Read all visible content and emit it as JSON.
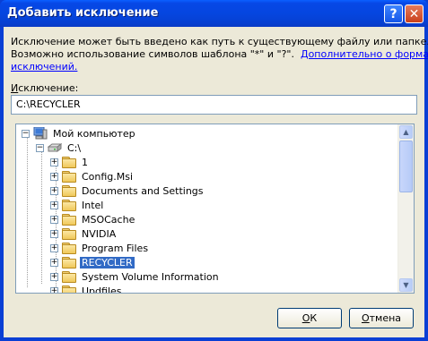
{
  "window": {
    "title": "Добавить исключение",
    "help_glyph": "?",
    "close_glyph": "✕"
  },
  "description": {
    "line1": "Исключение может быть введено как путь к существующему файлу или папке.",
    "line2_prefix": "Возможно использование символов шаблона \"*\" и \"?\".",
    "link_part1": "Дополнительно о форматах",
    "link_part2": "исключений."
  },
  "exclusion": {
    "label_first": "И",
    "label_rest": "сключение:",
    "value": "C:\\RECYCLER"
  },
  "tree": {
    "root": {
      "label": "Мой компьютер",
      "icon": "my-computer-icon",
      "expanded": true
    },
    "drive": {
      "label": "C:\\",
      "icon": "hard-drive-icon",
      "expanded": true
    },
    "folders": [
      {
        "label": "1",
        "icon": "folder-icon",
        "expander": "+"
      },
      {
        "label": "Config.Msi",
        "icon": "folder-icon",
        "expander": "+"
      },
      {
        "label": "Documents and Settings",
        "icon": "folder-icon",
        "expander": "+"
      },
      {
        "label": "Intel",
        "icon": "folder-icon",
        "expander": "+"
      },
      {
        "label": "MSOCache",
        "icon": "folder-icon",
        "expander": "+"
      },
      {
        "label": "NVIDIA",
        "icon": "folder-icon",
        "expander": "+"
      },
      {
        "label": "Program Files",
        "icon": "folder-icon",
        "expander": "+"
      },
      {
        "label": "RECYCLER",
        "icon": "folder-icon",
        "expander": "+",
        "selected": true
      },
      {
        "label": "System Volume Information",
        "icon": "folder-icon",
        "expander": "+"
      },
      {
        "label": "Updfiles",
        "icon": "folder-icon",
        "expander": "+"
      }
    ],
    "root_expander": "−",
    "drive_expander": "−"
  },
  "buttons": {
    "ok_first": "О",
    "ok_rest": "К",
    "cancel_first": "О",
    "cancel_rest": "тмена"
  },
  "colors": {
    "titlebar": "#0546e0",
    "dialog_bg": "#ece9d8",
    "selection": "#316ac5",
    "link": "#0000ff"
  }
}
